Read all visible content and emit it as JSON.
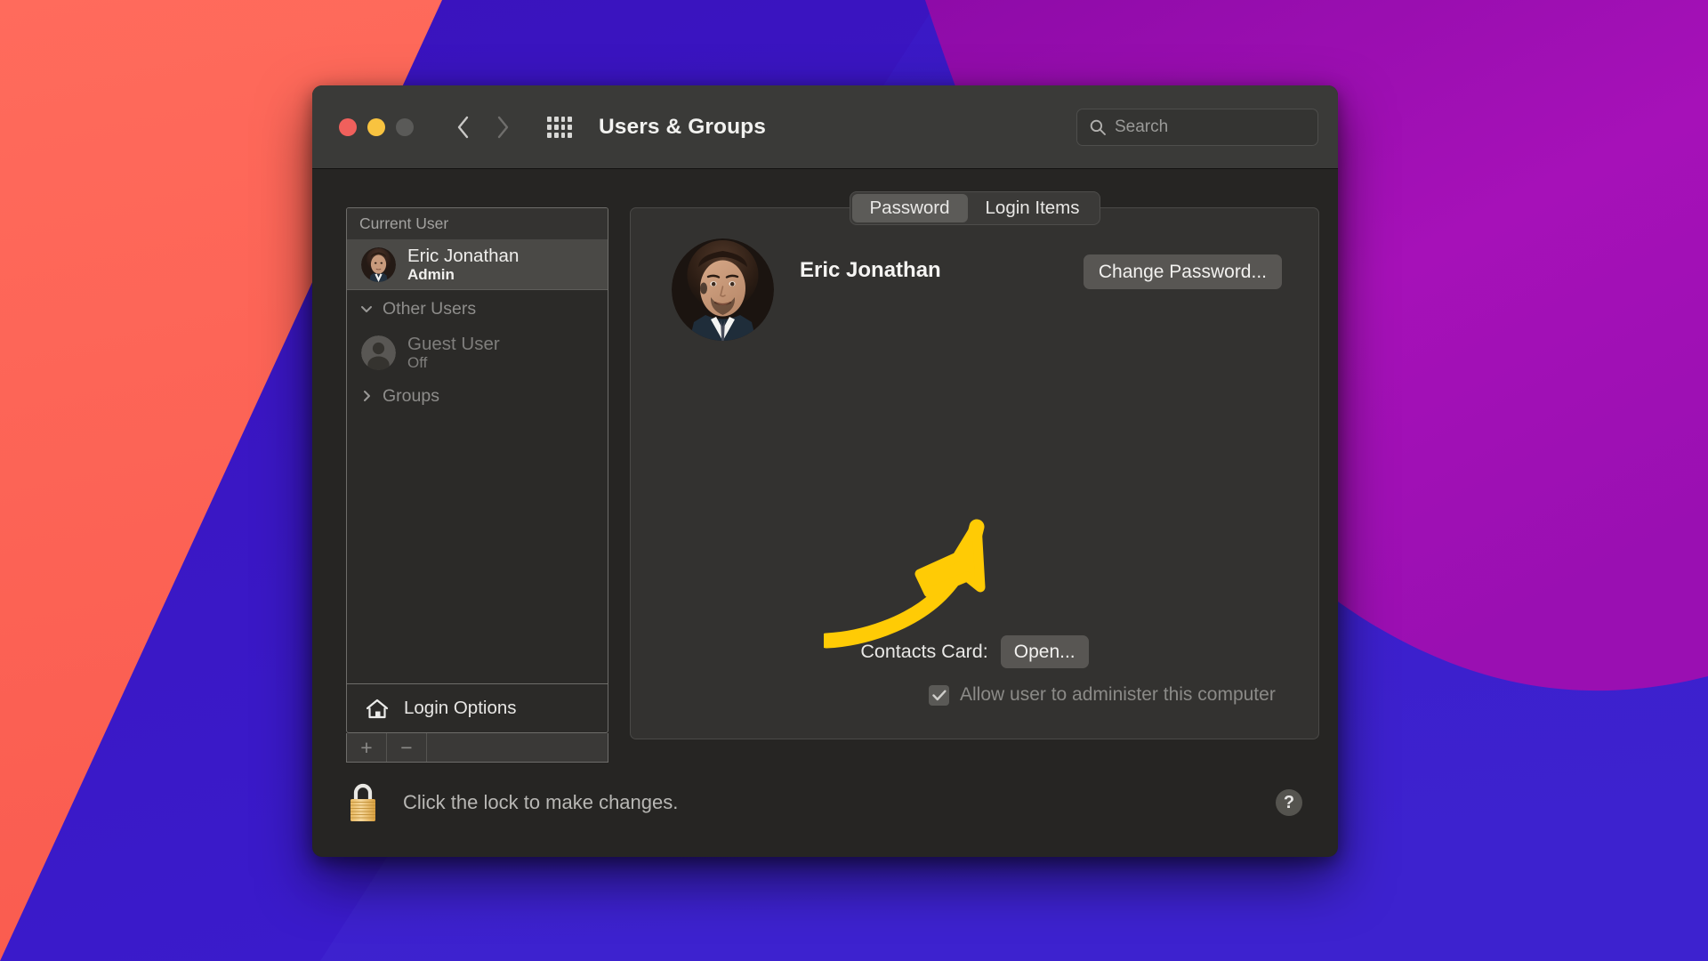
{
  "desktop": {
    "wallpaper_colors": {
      "coral": "#FF6155",
      "indigo": "#3512B0",
      "purple": "#9B0BAE",
      "blue": "#3B1BC8",
      "magenta": "#A011B5"
    }
  },
  "window": {
    "title": "Users & Groups",
    "traffic_lights": {
      "close": "close-button",
      "minimize": "minimize-button",
      "zoom": "zoom-button"
    },
    "nav": {
      "back_icon": "chevron-left-icon",
      "forward_icon": "chevron-right-icon",
      "grid_icon": "grid-show-all-icon"
    },
    "search": {
      "placeholder": "Search",
      "value": "",
      "icon": "search-icon"
    }
  },
  "sidebar": {
    "header": "Current User",
    "current_user": {
      "name": "Eric Jonathan",
      "role": "Admin",
      "avatar": "user-photo-avatar",
      "selected": true
    },
    "other_users": {
      "label": "Other Users",
      "chevron": "chevron-down-icon",
      "expanded": true,
      "users": [
        {
          "name": "Guest User",
          "status": "Off",
          "avatar": "generic-person-avatar"
        }
      ]
    },
    "groups": {
      "label": "Groups",
      "chevron": "chevron-right-icon",
      "expanded": false
    },
    "login_options": {
      "label": "Login Options",
      "icon": "home-house-icon"
    },
    "footer_buttons": {
      "add": "+",
      "remove": "−"
    }
  },
  "main": {
    "tabs": [
      {
        "label": "Password",
        "active": true
      },
      {
        "label": "Login Items",
        "active": false
      }
    ],
    "profile": {
      "avatar": "user-photo-avatar",
      "name": "Eric Jonathan",
      "change_password_label": "Change Password..."
    },
    "contacts_card": {
      "label": "Contacts Card:",
      "button_label": "Open..."
    },
    "admin_checkbox": {
      "label": "Allow user to administer this computer",
      "checked": true,
      "enabled": false
    }
  },
  "footer": {
    "lock_icon": "closed-padlock-icon",
    "lock_text": "Click the lock to make changes.",
    "help_label": "?"
  },
  "annotation": {
    "arrow": "yellow-curved-arrow-pointing-to-avatar",
    "color": "#FFCC00"
  }
}
